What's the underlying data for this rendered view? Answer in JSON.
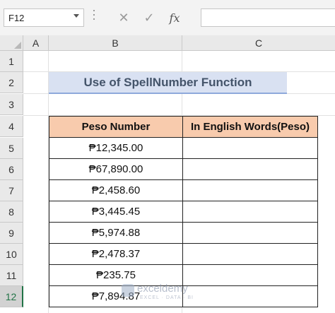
{
  "formula_bar": {
    "name_box": "F12",
    "icons": [
      "more-icon",
      "cancel-icon",
      "enter-icon",
      "function-icon"
    ],
    "fx_label": "fx",
    "formula": ""
  },
  "columns": [
    "A",
    "B",
    "C"
  ],
  "rows": [
    "1",
    "2",
    "3",
    "4",
    "5",
    "6",
    "7",
    "8",
    "9",
    "10",
    "11",
    "12"
  ],
  "active_row": "12",
  "title": "Use of SpellNumber Function",
  "table": {
    "headers": [
      "Peso Number",
      "In English Words(Peso)"
    ],
    "rows": [
      [
        "₱12,345.00",
        ""
      ],
      [
        "₱67,890.00",
        ""
      ],
      [
        "₱2,458.60",
        ""
      ],
      [
        "₱3,445.45",
        ""
      ],
      [
        "₱5,974.88",
        ""
      ],
      [
        "₱2,478.37",
        ""
      ],
      [
        "₱235.75",
        ""
      ],
      [
        "₱7,894.87",
        ""
      ]
    ]
  },
  "watermark": {
    "name": "exceldemy",
    "tagline": "EXCEL · DATA · BI"
  },
  "colors": {
    "title_bg": "#d9e1f2",
    "title_border": "#8ea9db",
    "header_bg": "#f8cbad",
    "active_accent": "#217346"
  }
}
